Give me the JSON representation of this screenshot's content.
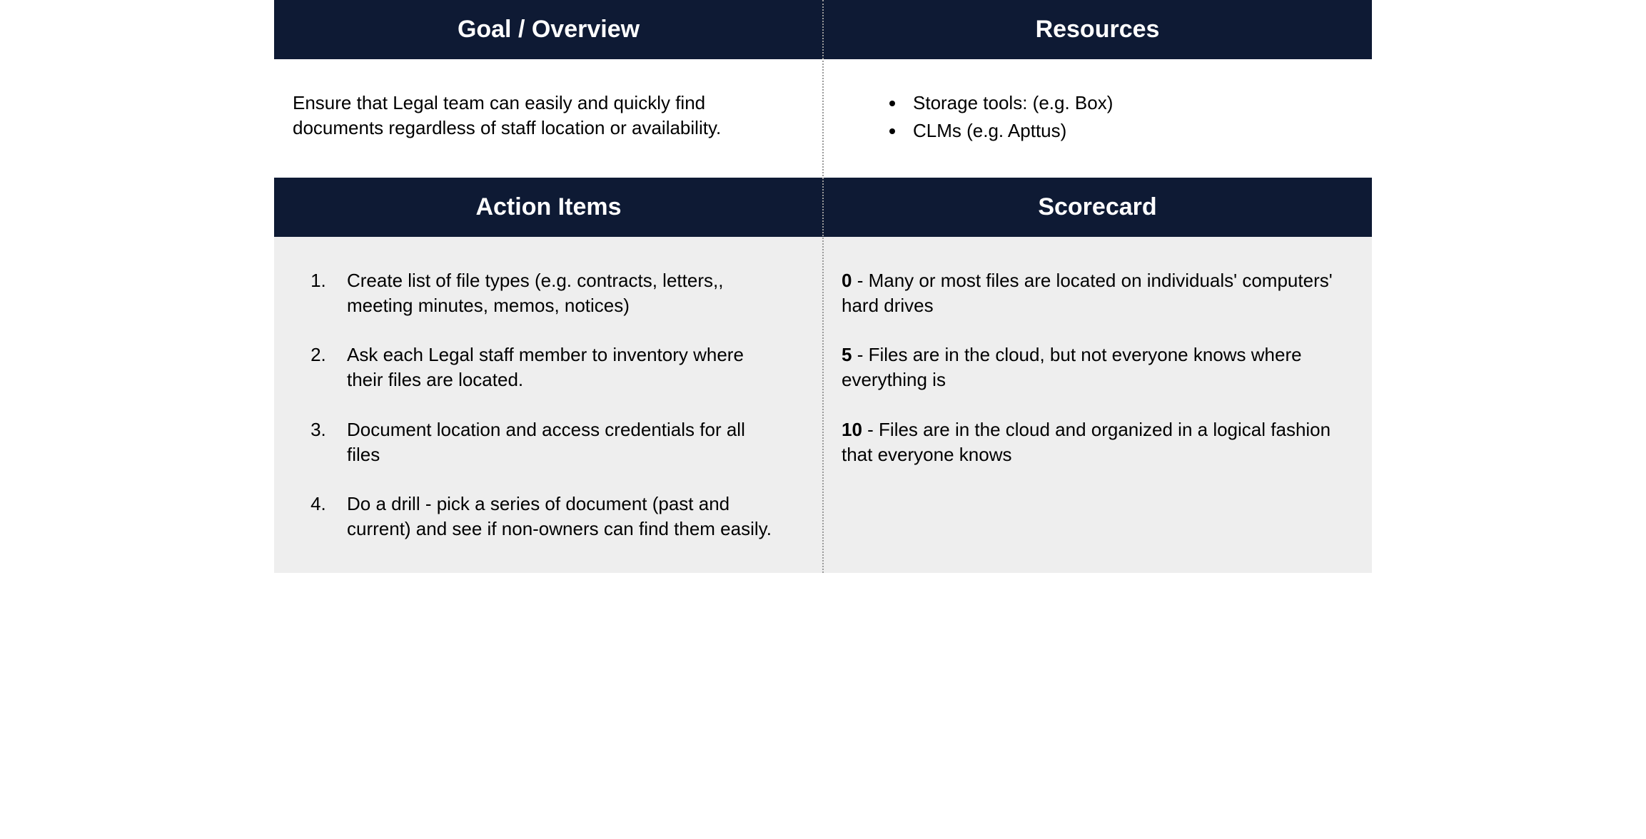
{
  "goal": {
    "header": "Goal / Overview",
    "text": "Ensure that Legal team can easily and quickly find documents regardless of staff location or availability."
  },
  "resources": {
    "header": "Resources",
    "items": [
      "Storage tools: (e.g. Box)",
      "CLMs (e.g. Apttus)"
    ]
  },
  "actions": {
    "header": "Action Items",
    "items": [
      "Create list of file types (e.g. contracts, letters,, meeting minutes, memos, notices)",
      "Ask each Legal staff member to inventory where their files are located.",
      "Document location and access credentials for all files",
      "Do a drill - pick a series of document (past and current) and see if non-owners can find them easily."
    ]
  },
  "scorecard": {
    "header": "Scorecard",
    "items": [
      {
        "score": "0",
        "text": "Many or most files are located on individuals' computers' hard drives"
      },
      {
        "score": "5",
        "text": "Files are in the cloud, but not everyone knows where everything is"
      },
      {
        "score": "10",
        "text": "Files are in the cloud and organized in a logical fashion that everyone knows"
      }
    ]
  }
}
